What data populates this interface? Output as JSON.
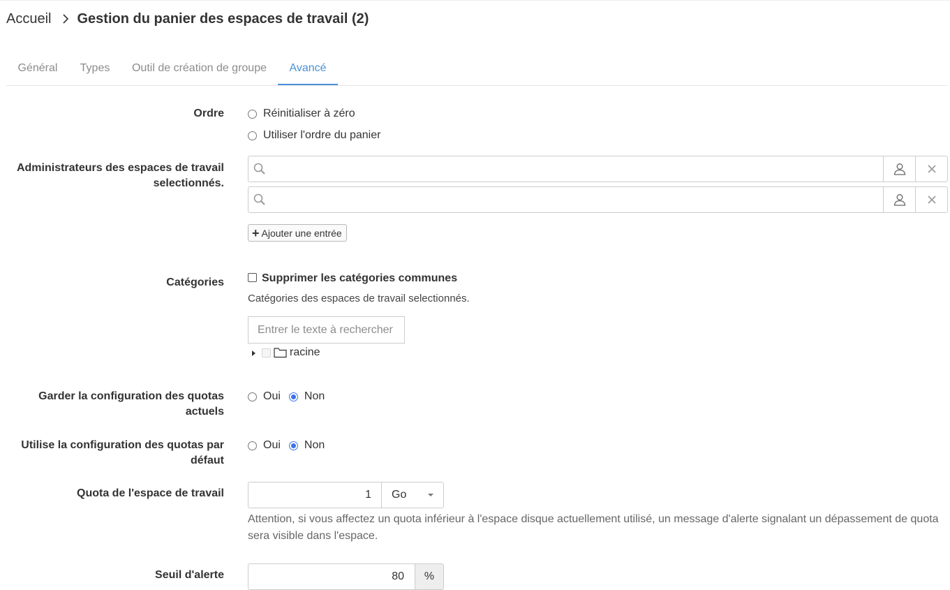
{
  "breadcrumb": {
    "home": "Accueil",
    "title": "Gestion du panier des espaces de travail (2)"
  },
  "tabs": [
    {
      "label": "Général",
      "active": false
    },
    {
      "label": "Types",
      "active": false
    },
    {
      "label": "Outil de création de groupe",
      "active": false
    },
    {
      "label": "Avancé",
      "active": true
    }
  ],
  "ordre": {
    "label": "Ordre",
    "options": [
      {
        "label": "Réinitialiser à zéro",
        "checked": false
      },
      {
        "label": "Utiliser l'ordre du panier",
        "checked": false
      }
    ]
  },
  "admins": {
    "label_line1": "Administrateurs des espaces de travail",
    "label_line2": "selectionnés.",
    "fields": [
      {
        "value": ""
      },
      {
        "value": ""
      }
    ],
    "add_label": "Ajouter une entrée"
  },
  "categories": {
    "label": "Catégories",
    "remove_common_label": "Supprimer les catégories communes",
    "remove_common_checked": false,
    "description": "Catégories des espaces de travail selectionnés.",
    "search_placeholder": "Entrer le texte à rechercher",
    "tree_root": "racine"
  },
  "keep_quota": {
    "label_line1": "Garder la configuration des quotas",
    "label_line2": "actuels",
    "yes": "Oui",
    "no": "Non",
    "selected": "Non"
  },
  "default_quota": {
    "label_line1": "Utilise la configuration des quotas par",
    "label_line2": "défaut",
    "yes": "Oui",
    "no": "Non",
    "selected": "Non"
  },
  "quota": {
    "label": "Quota de l'espace de travail",
    "value": "1",
    "unit": "Go",
    "help": "Attention, si vous affectez un quota inférieur à l'espace disque actuellement utilisé, un message d'alerte signalant un dépassement de quota sera visible dans l'espace."
  },
  "seuil": {
    "label": "Seuil d'alerte",
    "value": "80",
    "unit": "%"
  },
  "icons": {
    "breadcrumb_separator": "chevron-right-icon",
    "search": "search-icon",
    "user": "user-icon",
    "clear": "close-icon",
    "add": "plus-icon",
    "folder": "folder-icon",
    "tree_toggle": "caret-right-icon",
    "select_caret": "caret-down-icon"
  },
  "colors": {
    "accent": "#4a90d9",
    "radio_checked": "#3b73e8",
    "text": "#333333",
    "muted": "#8c8c8c"
  }
}
